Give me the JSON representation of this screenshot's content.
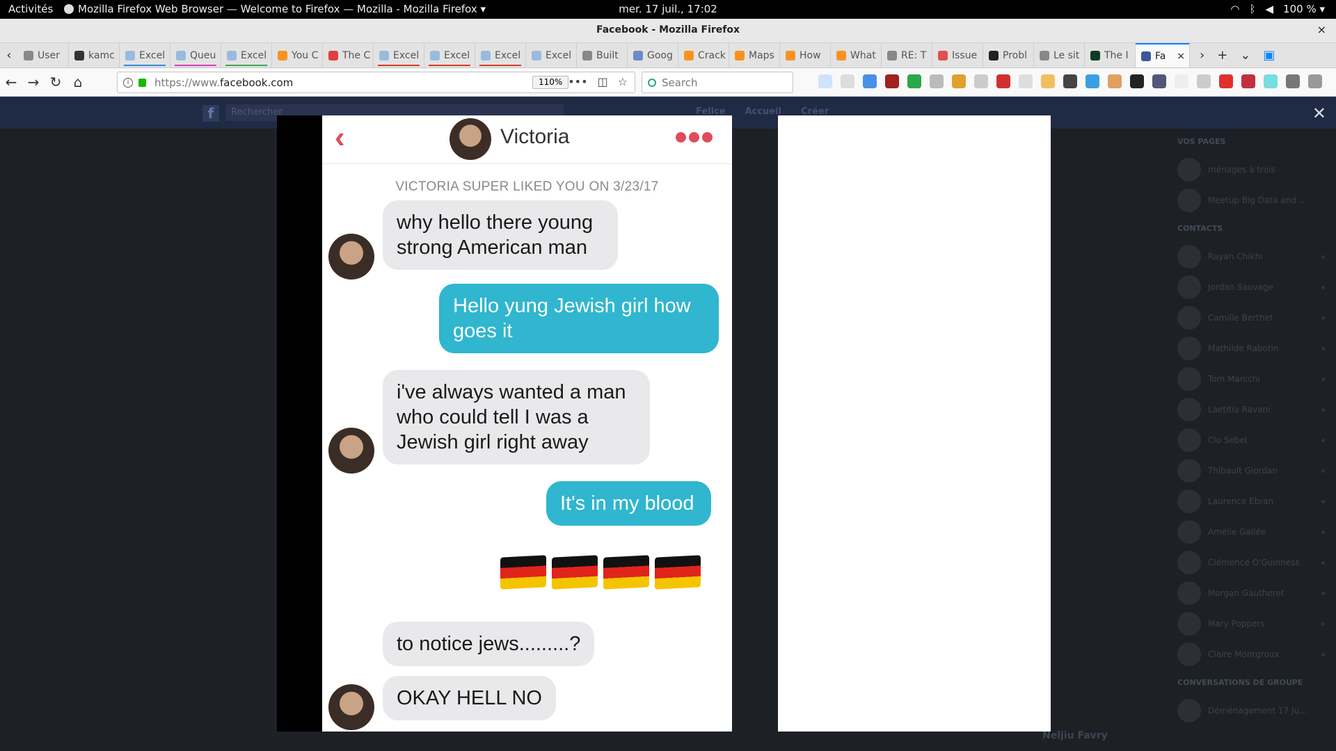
{
  "gnome": {
    "activities": "Activités",
    "app_menu": "Mozilla Firefox Web Browser — Welcome to Firefox — Mozilla - Mozilla Firefox ▾",
    "clock": "mer. 17 juil., 17:02",
    "battery": "100 % ▾"
  },
  "window": {
    "title": "Facebook - Mozilla Firefox"
  },
  "tabs": [
    {
      "label": "User",
      "fav": "#888"
    },
    {
      "label": "kamc",
      "fav": "#333"
    },
    {
      "label": "Excel",
      "fav": "#9bd",
      "uline": "#2b8dd6"
    },
    {
      "label": "Queu",
      "fav": "#9bd",
      "uline": "#d43dbf"
    },
    {
      "label": "Excel",
      "fav": "#9bd",
      "uline": "#3aa84a"
    },
    {
      "label": "You C",
      "fav": "#f7931e"
    },
    {
      "label": "The C",
      "fav": "#e04040"
    },
    {
      "label": "Excel",
      "fav": "#9bd",
      "uline": "#d63a2b"
    },
    {
      "label": "Excel",
      "fav": "#9bd",
      "uline": "#d63a2b"
    },
    {
      "label": "Excel",
      "fav": "#9bd",
      "uline": "#d63a2b"
    },
    {
      "label": "Excel",
      "fav": "#9bd"
    },
    {
      "label": "Built",
      "fav": "#888"
    },
    {
      "label": "Goog",
      "fav": "#6b8cc7"
    },
    {
      "label": "Crack",
      "fav": "#f7931e"
    },
    {
      "label": "Maps",
      "fav": "#f7931e"
    },
    {
      "label": "How",
      "fav": "#f7931e"
    },
    {
      "label": "What",
      "fav": "#f7931e"
    },
    {
      "label": "RE: T",
      "fav": "#888"
    },
    {
      "label": "Issue",
      "fav": "#e05050"
    },
    {
      "label": "Probl",
      "fav": "#222"
    },
    {
      "label": "Le sit",
      "fav": "#888"
    },
    {
      "label": "The I",
      "fav": "#0c3c26"
    }
  ],
  "active_tab": {
    "label": "Fa",
    "fav": "#3b5998"
  },
  "urlbar": {
    "scheme": "https://www.",
    "host": "facebook.com",
    "zoom": "110%"
  },
  "searchbar": {
    "placeholder": "Search"
  },
  "fb": {
    "logo": "f",
    "search_placeholder": "Rechercher",
    "nav": [
      "Felice",
      "Accueil",
      "Créer"
    ],
    "sidebar_pages_title": "VOS PAGES",
    "pages": [
      "ménages à trois",
      "Meetup Big Data and ..."
    ],
    "contacts_title": "CONTACTS",
    "contacts": [
      "Rayan Chikhi",
      "Jordan Sauvage",
      "Camille Berthet",
      "Mathilde Rabotin",
      "Tom Marcchi",
      "Laetitia Ravani",
      "Clo Sebel",
      "Thibault Giordan",
      "Laurence Ebran",
      "Amélie Gallée",
      "Clémence O'Guinness",
      "Morgan Gautheret",
      "Mary Poppers",
      "Claire Montgroux"
    ],
    "groups_title": "CONVERSATIONS DE GROUPE",
    "groups": [
      "Déménagement 17 Ju..."
    ],
    "chat_name": "Neljiu Favry"
  },
  "conversation": {
    "contact_name": "Victoria",
    "superlike_notice": "VICTORIA SUPER LIKED YOU ON 3/23/17",
    "messages": [
      {
        "from": "them",
        "text": "why hello there young strong American man"
      },
      {
        "from": "me",
        "text": "Hello yung Jewish girl how goes it"
      },
      {
        "from": "them",
        "text": "i've always wanted a man who could tell I was a Jewish girl right away"
      },
      {
        "from": "me",
        "text": "It's in my blood"
      },
      {
        "from": "me",
        "text": "🇩🇪🇩🇪🇩🇪🇩🇪"
      },
      {
        "from": "them",
        "text": "to notice jews.........?"
      },
      {
        "from": "them",
        "text": "OKAY HELL NO"
      }
    ]
  },
  "icons": {
    "back": "‹",
    "close": "×",
    "lightbox_close": "✕"
  }
}
